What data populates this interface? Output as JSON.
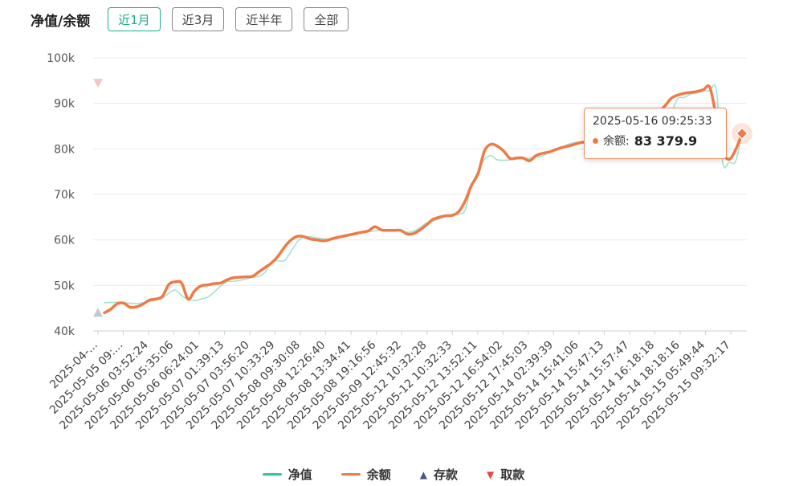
{
  "header": {
    "title": "净值/余额",
    "tabs": [
      {
        "label": "近1月",
        "active": true
      },
      {
        "label": "近3月",
        "active": false
      },
      {
        "label": "近半年",
        "active": false
      },
      {
        "label": "全部",
        "active": false
      }
    ]
  },
  "tooltip": {
    "time": "2025-05-16 09:25:33",
    "label": "余额:",
    "value": "83 379.9"
  },
  "legend": [
    {
      "label": "净值",
      "color": "#2ec4a4",
      "shape": "line"
    },
    {
      "label": "余额",
      "color": "#f07a45",
      "shape": "line"
    },
    {
      "label": "存款",
      "color": "#4a5a7a",
      "shape": "triangle-up"
    },
    {
      "label": "取款",
      "color": "#e8453c",
      "shape": "triangle-down"
    }
  ],
  "chart_data": {
    "type": "line",
    "ylim": [
      40000,
      100000
    ],
    "yticks": [
      40000,
      50000,
      60000,
      70000,
      80000,
      90000,
      100000
    ],
    "ytick_labels": [
      "40k",
      "50k",
      "60k",
      "70k",
      "80k",
      "90k",
      "100k"
    ],
    "xtick_labels": [
      "2025-04-...",
      "2025-05-05 09:...",
      "2025-05-06 03:52:24",
      "2025-05-06 05:35:06",
      "2025-05-06 06:24:01",
      "2025-05-07 01:39:13",
      "2025-05-07 03:56:20",
      "2025-05-07 10:33:29",
      "2025-05-08 09:30:08",
      "2025-05-08 12:26:40",
      "2025-05-08 13:34:41",
      "2025-05-08 19:16:56",
      "2025-05-09 12:45:32",
      "2025-05-12 10:32:28",
      "2025-05-12 10:32:33",
      "2025-05-12 13:52:11",
      "2025-05-12 16:54:02",
      "2025-05-12 17:45:03",
      "2025-05-14 02:39:39",
      "2025-05-14 15:41:06",
      "2025-05-14 15:47:13",
      "2025-05-14 15:57:47",
      "2025-05-14 16:18:18",
      "2025-05-14 18:18:16",
      "2025-05-15 05:49:44",
      "2025-05-15 09:32:17"
    ],
    "x_index_max": 100,
    "series": [
      {
        "name": "净值",
        "color": "#2ec4a4",
        "points": [
          [
            1,
            46200
          ],
          [
            3,
            46300
          ],
          [
            4,
            46200
          ],
          [
            5,
            46100
          ],
          [
            6,
            46000
          ],
          [
            7,
            46200
          ],
          [
            8,
            46500
          ],
          [
            9,
            46800
          ],
          [
            10,
            47200
          ],
          [
            11,
            48300
          ],
          [
            12,
            49000
          ],
          [
            13,
            47800
          ],
          [
            14,
            46900
          ],
          [
            15,
            46700
          ],
          [
            16,
            47000
          ],
          [
            17,
            47400
          ],
          [
            18,
            48500
          ],
          [
            19,
            49800
          ],
          [
            20,
            50800
          ],
          [
            21,
            50900
          ],
          [
            22,
            51100
          ],
          [
            23,
            51400
          ],
          [
            24,
            51800
          ],
          [
            25,
            52000
          ],
          [
            26,
            53000
          ],
          [
            27,
            55300
          ],
          [
            28,
            55400
          ],
          [
            29,
            55500
          ],
          [
            30,
            57500
          ],
          [
            31,
            59700
          ],
          [
            32,
            60600
          ],
          [
            33,
            60700
          ],
          [
            34,
            60400
          ],
          [
            35,
            60300
          ],
          [
            36,
            60100
          ],
          [
            37,
            60300
          ],
          [
            38,
            60600
          ],
          [
            39,
            60900
          ],
          [
            40,
            61300
          ],
          [
            41,
            61600
          ],
          [
            42,
            61800
          ],
          [
            43,
            62000
          ],
          [
            44,
            62100
          ],
          [
            45,
            62200
          ],
          [
            46,
            62100
          ],
          [
            47,
            62000
          ],
          [
            48,
            61700
          ],
          [
            49,
            61900
          ],
          [
            50,
            62700
          ],
          [
            51,
            63700
          ],
          [
            52,
            64200
          ],
          [
            53,
            64600
          ],
          [
            54,
            65200
          ],
          [
            55,
            65600
          ],
          [
            56,
            65700
          ],
          [
            57,
            66500
          ],
          [
            58,
            72000
          ],
          [
            59,
            75000
          ],
          [
            60,
            77700
          ],
          [
            61,
            78500
          ],
          [
            62,
            77600
          ],
          [
            63,
            77500
          ],
          [
            64,
            77600
          ],
          [
            65,
            77800
          ],
          [
            66,
            77900
          ],
          [
            67,
            78000
          ],
          [
            68,
            78200
          ],
          [
            69,
            78400
          ],
          [
            70,
            79200
          ],
          [
            71,
            79700
          ],
          [
            72,
            80300
          ],
          [
            73,
            81000
          ],
          [
            74,
            81400
          ],
          [
            75,
            81500
          ],
          [
            76,
            81600
          ],
          [
            77,
            81700
          ],
          [
            78,
            81800
          ],
          [
            79,
            85400
          ],
          [
            80,
            85500
          ],
          [
            81,
            84900
          ],
          [
            82,
            86100
          ],
          [
            83,
            86300
          ],
          [
            84,
            86500
          ],
          [
            85,
            86700
          ],
          [
            86,
            86900
          ],
          [
            87,
            87200
          ],
          [
            88,
            87600
          ],
          [
            89,
            88000
          ],
          [
            90,
            91000
          ],
          [
            91,
            91300
          ],
          [
            92,
            92000
          ],
          [
            93,
            92300
          ],
          [
            94,
            92700
          ],
          [
            95,
            92800
          ],
          [
            96,
            93000
          ],
          [
            97,
            77000
          ],
          [
            98,
            77100
          ],
          [
            99,
            77300
          ],
          [
            100,
            83379.9
          ]
        ]
      },
      {
        "name": "余额",
        "color": "#f07a45",
        "points": [
          [
            1,
            44000
          ],
          [
            2,
            44800
          ],
          [
            3,
            46000
          ],
          [
            4,
            46100
          ],
          [
            5,
            45200
          ],
          [
            6,
            45300
          ],
          [
            7,
            45900
          ],
          [
            8,
            46800
          ],
          [
            9,
            47000
          ],
          [
            10,
            47600
          ],
          [
            11,
            50200
          ],
          [
            12,
            50800
          ],
          [
            13,
            50500
          ],
          [
            14,
            47000
          ],
          [
            15,
            48800
          ],
          [
            16,
            49900
          ],
          [
            17,
            50100
          ],
          [
            18,
            50400
          ],
          [
            19,
            50500
          ],
          [
            20,
            51200
          ],
          [
            21,
            51700
          ],
          [
            22,
            51800
          ],
          [
            23,
            51900
          ],
          [
            24,
            52000
          ],
          [
            25,
            53000
          ],
          [
            26,
            54000
          ],
          [
            27,
            55000
          ],
          [
            28,
            56500
          ],
          [
            29,
            58500
          ],
          [
            30,
            60000
          ],
          [
            31,
            60800
          ],
          [
            32,
            60700
          ],
          [
            33,
            60200
          ],
          [
            34,
            60000
          ],
          [
            35,
            59800
          ],
          [
            36,
            60100
          ],
          [
            37,
            60500
          ],
          [
            38,
            60800
          ],
          [
            39,
            61100
          ],
          [
            40,
            61400
          ],
          [
            41,
            61700
          ],
          [
            42,
            62000
          ],
          [
            43,
            62900
          ],
          [
            44,
            62200
          ],
          [
            45,
            62100
          ],
          [
            46,
            62100
          ],
          [
            47,
            62100
          ],
          [
            48,
            61300
          ],
          [
            49,
            61400
          ],
          [
            50,
            62200
          ],
          [
            51,
            63300
          ],
          [
            52,
            64500
          ],
          [
            53,
            65000
          ],
          [
            54,
            65300
          ],
          [
            55,
            65400
          ],
          [
            56,
            66200
          ],
          [
            57,
            68500
          ],
          [
            58,
            72000
          ],
          [
            59,
            74500
          ],
          [
            60,
            79500
          ],
          [
            61,
            81000
          ],
          [
            62,
            80600
          ],
          [
            63,
            79500
          ],
          [
            64,
            77900
          ],
          [
            65,
            78000
          ],
          [
            66,
            78000
          ],
          [
            67,
            77400
          ],
          [
            68,
            78500
          ],
          [
            69,
            79000
          ],
          [
            70,
            79300
          ],
          [
            71,
            79800
          ],
          [
            72,
            80300
          ],
          [
            73,
            80600
          ],
          [
            74,
            81000
          ],
          [
            75,
            81400
          ],
          [
            76,
            81500
          ],
          [
            77,
            81700
          ],
          [
            78,
            82000
          ],
          [
            79,
            82500
          ],
          [
            80,
            84600
          ],
          [
            81,
            85200
          ],
          [
            82,
            86200
          ],
          [
            83,
            86700
          ],
          [
            84,
            87000
          ],
          [
            85,
            87300
          ],
          [
            86,
            87700
          ],
          [
            87,
            88200
          ],
          [
            88,
            89400
          ],
          [
            89,
            91100
          ],
          [
            90,
            91800
          ],
          [
            91,
            92200
          ],
          [
            92,
            92400
          ],
          [
            93,
            92600
          ],
          [
            94,
            93000
          ],
          [
            95,
            93500
          ],
          [
            96,
            87000
          ],
          [
            97,
            79500
          ],
          [
            98,
            77700
          ],
          [
            99,
            79800
          ],
          [
            100,
            83379.9
          ]
        ]
      }
    ],
    "markers": [
      {
        "type": "存款",
        "x": 0,
        "value": 44000
      },
      {
        "type": "取款",
        "x": 0,
        "value": 94500
      }
    ],
    "highlight": {
      "x": 100,
      "value": 83379.9
    }
  }
}
